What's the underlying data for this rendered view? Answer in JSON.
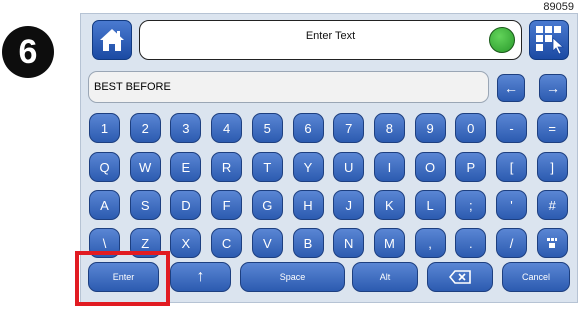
{
  "figure_id": "89059",
  "step_number": "6",
  "header": {
    "title": "Enter Text"
  },
  "text_field": {
    "value": "BEST BEFORE"
  },
  "nav": {
    "left_arrow": "←",
    "right_arrow": "→"
  },
  "keyboard": {
    "row1": [
      "1",
      "2",
      "3",
      "4",
      "5",
      "6",
      "7",
      "8",
      "9",
      "0",
      "-",
      "="
    ],
    "row2": [
      "Q",
      "W",
      "E",
      "R",
      "T",
      "Y",
      "U",
      "I",
      "O",
      "P",
      "[",
      "]"
    ],
    "row3": [
      "A",
      "S",
      "D",
      "F",
      "G",
      "H",
      "J",
      "K",
      "L",
      ";",
      "'",
      "#"
    ],
    "row4": [
      "\\",
      "Z",
      "X",
      "C",
      "V",
      "B",
      "N",
      "M",
      ",",
      ".",
      "/",
      ""
    ],
    "bottom": {
      "enter": "Enter",
      "shift": "↑",
      "space": "Space",
      "alt": "Alt",
      "cancel": "Cancel"
    }
  },
  "colors": {
    "key": "#2c5bb0",
    "status_indicator": "#2a9a2c",
    "highlight": "#e11b22"
  }
}
